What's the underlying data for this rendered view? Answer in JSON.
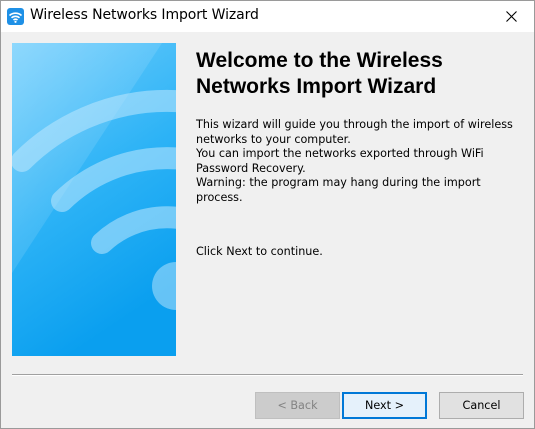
{
  "window": {
    "title": "Wireless Networks Import Wizard",
    "icon": "wifi-app-icon",
    "close_icon": "close-icon"
  },
  "main": {
    "heading": "Welcome to the Wireless Networks Import Wizard",
    "description_lines": [
      "This wizard will guide you through the import of wireless",
      "networks to your computer.",
      "You can import the networks exported through WiFi",
      "Password Recovery.",
      "Warning: the program may hang during the import",
      "process."
    ],
    "continue_text": "Click Next to continue."
  },
  "buttons": {
    "back": "< Back",
    "next": "Next >",
    "cancel": "Cancel"
  },
  "colors": {
    "banner_top": "#5ec6fb",
    "banner_bottom": "#0aa0f0",
    "accent": "#0078d7"
  }
}
